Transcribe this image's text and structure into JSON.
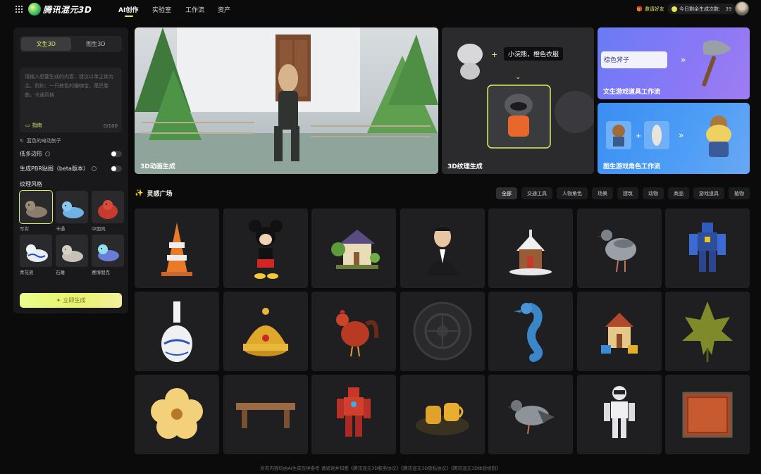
{
  "brand": {
    "name": "腾讯混元3D"
  },
  "nav": {
    "items": [
      "AI创作",
      "实验室",
      "工作流",
      "资产"
    ]
  },
  "header": {
    "invite": "邀请好友",
    "remaining_label": "今日剩余生成次数:",
    "remaining_count": "39"
  },
  "panel": {
    "tabs": [
      "文生3D",
      "图生3D"
    ],
    "prompt_placeholder": "请输入想要生成的内容，建议以单主体为主。例如：一只棕色的猫嗨宝，尾巴卷曲，卡通风格",
    "guide": "指南",
    "counter": "0/100",
    "sample_prompt": "蓝色的电动刨子",
    "options": [
      {
        "label": "低多边形"
      },
      {
        "label": "生成PBR贴图（beta版本）"
      }
    ],
    "style_title": "纹理风格",
    "styles": [
      "写实",
      "卡通",
      "中国风",
      "青花瓷",
      "石雕",
      "赛博朋克"
    ],
    "generate": "立即生成"
  },
  "banners": {
    "b1": "3D动画生成",
    "b2": "3D纹理生成",
    "b2_prompt": "小浣熊，橙色衣服",
    "b3": "文生游戏道具工作流",
    "b3_prompt": "棕色斧子",
    "b4": "图生游戏角色工作流"
  },
  "inspiration": {
    "title": "灵感广场",
    "categories": [
      "全部",
      "交通工具",
      "人物角色",
      "场景",
      "建筑",
      "动物",
      "商品",
      "游戏道具",
      "植物"
    ]
  },
  "gallery_items": [
    "traffic-cone",
    "mickey-figure",
    "cottage",
    "businessman-bust",
    "snow-cabin",
    "pigeon",
    "mech-robot",
    "porcelain-vase",
    "golden-crown",
    "rooster",
    "carved-disc",
    "seahorse",
    "toy-house",
    "maple-leaf",
    "yellow-flower",
    "wooden-bench",
    "red-robot",
    "teacups-tray",
    "pigeon-2",
    "white-robot",
    "ornate-box"
  ],
  "footer": "所有内容均由AI生成仅供参考 请阅读并知悉《腾讯混元3D服务协议》《腾讯混元3D隐私协议》《腾讯混元3D体验规则》"
}
